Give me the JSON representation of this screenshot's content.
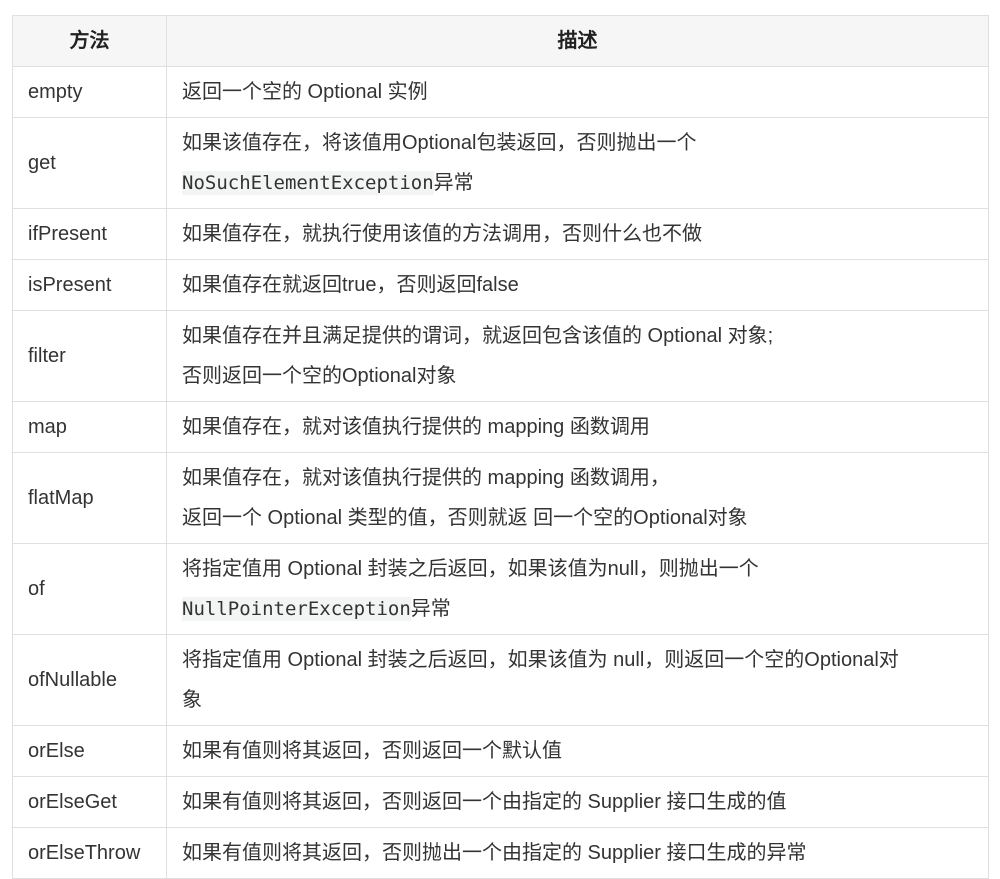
{
  "table": {
    "headers": [
      "方法",
      "描述"
    ],
    "rows": [
      {
        "method": "empty",
        "lines": [
          {
            "text": "返回一个空的 Optional 实例"
          }
        ]
      },
      {
        "method": "get",
        "lines": [
          {
            "text": "如果该值存在，将该值用Optional包装返回，否则抛出一个"
          },
          {
            "code": "NoSuchElementException",
            "text": "异常"
          }
        ]
      },
      {
        "method": "ifPresent",
        "lines": [
          {
            "text": "如果值存在，就执行使用该值的方法调用，否则什么也不做"
          }
        ]
      },
      {
        "method": "isPresent",
        "lines": [
          {
            "text": "如果值存在就返回true，否则返回false"
          }
        ]
      },
      {
        "method": "filter",
        "lines": [
          {
            "text": "如果值存在并且满足提供的谓词，就返回包含该值的 Optional 对象;"
          },
          {
            "text": "否则返回一个空的Optional对象"
          }
        ]
      },
      {
        "method": "map",
        "lines": [
          {
            "text": "如果值存在，就对该值执行提供的 mapping 函数调用"
          }
        ]
      },
      {
        "method": "flatMap",
        "lines": [
          {
            "text": "如果值存在，就对该值执行提供的 mapping 函数调用，"
          },
          {
            "text": "返回一个 Optional 类型的值，否则就返 回一个空的Optional对象"
          }
        ]
      },
      {
        "method": "of",
        "lines": [
          {
            "text": "将指定值用 Optional 封装之后返回，如果该值为null，则抛出一个"
          },
          {
            "code": "NullPointerException",
            "text": "异常"
          }
        ]
      },
      {
        "method": "ofNullable",
        "lines": [
          {
            "text": "将指定值用 Optional 封装之后返回，如果该值为 null，则返回一个空的Optional对"
          },
          {
            "text": "象"
          }
        ]
      },
      {
        "method": "orElse",
        "lines": [
          {
            "text": "如果有值则将其返回，否则返回一个默认值"
          }
        ]
      },
      {
        "method": "orElseGet",
        "lines": [
          {
            "text": "如果有值则将其返回，否则返回一个由指定的 Supplier 接口生成的值"
          }
        ]
      },
      {
        "method": "orElseThrow",
        "lines": [
          {
            "text": "如果有值则将其返回，否则抛出一个由指定的 Supplier 接口生成的异常"
          }
        ]
      }
    ]
  }
}
